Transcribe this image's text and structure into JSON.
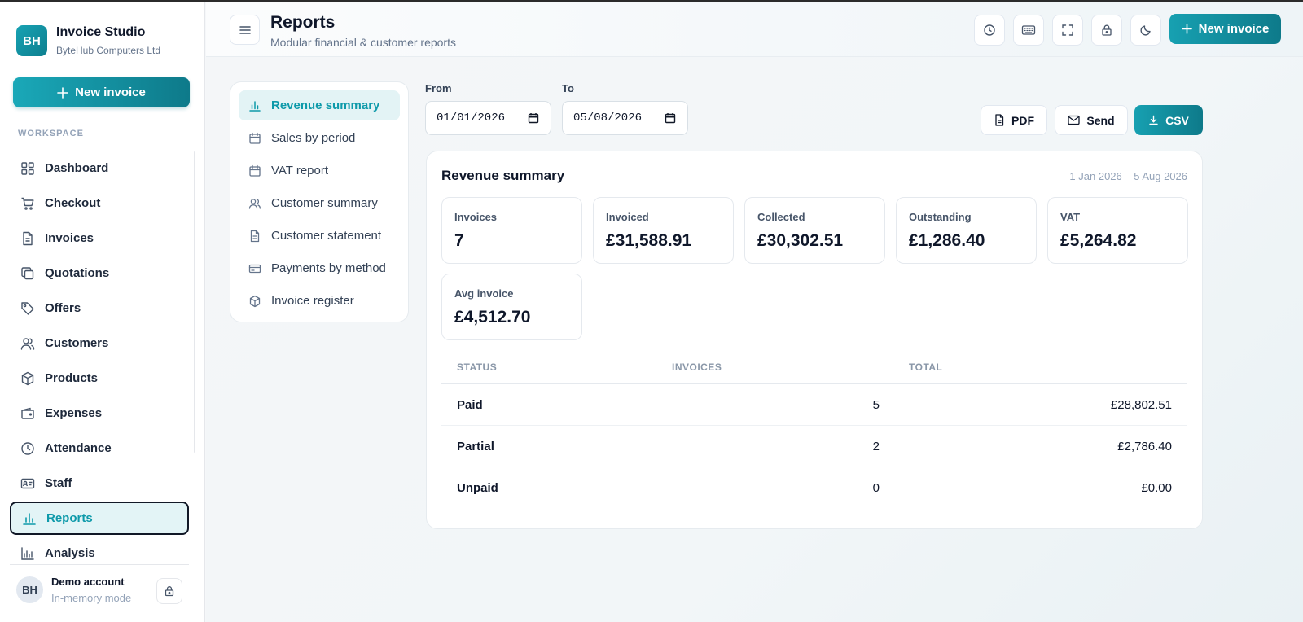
{
  "brand": {
    "logo": "BH",
    "name": "Invoice Studio",
    "company": "ByteHub Computers Ltd"
  },
  "sidebar": {
    "new_invoice_label": "New invoice",
    "section_label": "WORKSPACE",
    "items": [
      {
        "label": "Dashboard",
        "icon": "grid-icon"
      },
      {
        "label": "Checkout",
        "icon": "cart-icon"
      },
      {
        "label": "Invoices",
        "icon": "file-icon"
      },
      {
        "label": "Quotations",
        "icon": "copy-icon"
      },
      {
        "label": "Offers",
        "icon": "tag-icon"
      },
      {
        "label": "Customers",
        "icon": "users-icon"
      },
      {
        "label": "Products",
        "icon": "box-icon"
      },
      {
        "label": "Expenses",
        "icon": "wallet-icon"
      },
      {
        "label": "Attendance",
        "icon": "clock-icon"
      },
      {
        "label": "Staff",
        "icon": "id-card-icon"
      },
      {
        "label": "Reports",
        "icon": "bar-chart-icon",
        "active": true
      },
      {
        "label": "Analysis",
        "icon": "analytics-icon"
      }
    ],
    "account": {
      "initials": "BH",
      "name": "Demo account",
      "mode": "In-memory mode"
    }
  },
  "header": {
    "title": "Reports",
    "subtitle": "Modular financial & customer reports",
    "icons": [
      "history-icon",
      "keyboard-icon",
      "fullscreen-icon",
      "lock-icon",
      "moon-icon"
    ],
    "new_invoice_label": "New invoice"
  },
  "report_menu": {
    "items": [
      {
        "label": "Revenue summary",
        "icon": "bar-chart-icon",
        "active": true
      },
      {
        "label": "Sales by period",
        "icon": "calendar-icon"
      },
      {
        "label": "VAT report",
        "icon": "calendar-icon"
      },
      {
        "label": "Customer summary",
        "icon": "users-icon"
      },
      {
        "label": "Customer statement",
        "icon": "file-icon"
      },
      {
        "label": "Payments by method",
        "icon": "card-icon"
      },
      {
        "label": "Invoice register",
        "icon": "box-icon"
      }
    ]
  },
  "filters": {
    "from_label": "From",
    "from_value": "01/01/2026",
    "to_label": "To",
    "to_value": "05/08/2026"
  },
  "actions": {
    "pdf": "PDF",
    "send": "Send",
    "csv": "CSV"
  },
  "summary": {
    "title": "Revenue summary",
    "range": "1 Jan 2026 – 5 Aug 2026",
    "stats": [
      {
        "label": "Invoices",
        "value": "7"
      },
      {
        "label": "Invoiced",
        "value": "£31,588.91"
      },
      {
        "label": "Collected",
        "value": "£30,302.51"
      },
      {
        "label": "Outstanding",
        "value": "£1,286.40"
      },
      {
        "label": "VAT",
        "value": "£5,264.82"
      },
      {
        "label": "Avg invoice",
        "value": "£4,512.70"
      }
    ],
    "table": {
      "headers": [
        "STATUS",
        "INVOICES",
        "TOTAL"
      ],
      "rows": [
        {
          "status": "Paid",
          "invoices": "5",
          "total": "£28,802.51"
        },
        {
          "status": "Partial",
          "invoices": "2",
          "total": "£2,786.40"
        },
        {
          "status": "Unpaid",
          "invoices": "0",
          "total": "£0.00"
        }
      ]
    }
  },
  "colors": {
    "accent": "#0e9aaa",
    "accent_dark": "#0e7a8a"
  }
}
